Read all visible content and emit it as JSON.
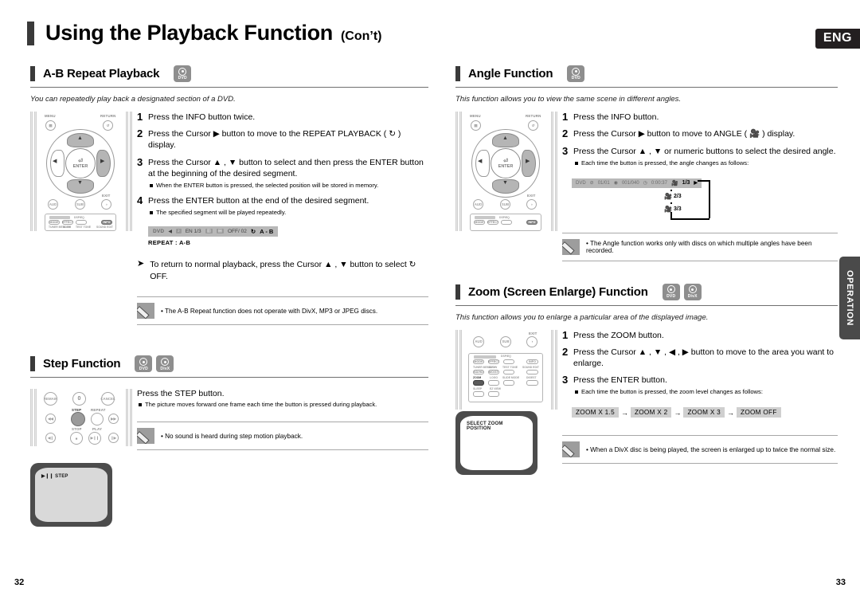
{
  "header": {
    "title_main": "Using the Playback Function",
    "title_sub": "(Con’t)",
    "lang_badge": "ENG"
  },
  "side_tab": {
    "label": "OPERATION"
  },
  "page_numbers": {
    "left": "32",
    "right": "33"
  },
  "sections": {
    "ab_repeat": {
      "title": "A-B Repeat Playback",
      "badges": [
        "DVD"
      ],
      "description": "You can repeatedly play back a designated section of a DVD.",
      "steps": [
        {
          "num": "1",
          "text": "Press the INFO button twice.",
          "bold": [
            "INFO"
          ]
        },
        {
          "num": "2",
          "text": "Press the Cursor ▶ button to move to the REPEAT PLAYBACK ( ↻ ) display."
        },
        {
          "num": "3",
          "text": "Press the Cursor ▲ , ▼ button to select <A-> and then press the ENTER button at the beginning of the desired segment.",
          "note": "When the ENTER button is pressed, the selected position will be stored in memory."
        },
        {
          "num": "4",
          "text": "Press the ENTER button at the end of the desired segment.",
          "note": "The specified segment will be played repeatedly."
        }
      ],
      "osd": {
        "disc": "DVD",
        "audio": "EN 1/3",
        "subtitle": "OFF/ 02",
        "mode": "A - B",
        "caption": "REPEAT : A-B"
      },
      "return_note": "To return to normal playback, press the Cursor ▲ , ▼ button to select ↻ OFF.",
      "note": "• The A-B Repeat function does not operate with DivX, MP3 or JPEG discs."
    },
    "step_function": {
      "title": "Step Function",
      "badges": [
        "DVD",
        "DivX"
      ],
      "lead": "Press the STEP button.",
      "lead_bold": "STEP",
      "bullet": "The picture moves forward one frame each time the button is pressed during playback.",
      "note": "• No sound is heard during step motion playback.",
      "tv_label": "▶❙❙ STEP"
    },
    "angle_function": {
      "title": "Angle Function",
      "badges": [
        "DVD"
      ],
      "description": "This function allows you to view the same scene in different angles.",
      "steps": [
        {
          "num": "1",
          "text": "Press the INFO button."
        },
        {
          "num": "2",
          "text": "Press the Cursor ▶ button to move to ANGLE ( 🎥 ) display."
        },
        {
          "num": "3",
          "text": "Press the Cursor ▲ , ▼ or numeric buttons to select the desired angle.",
          "note": "Each time the button is pressed, the angle changes as follows:"
        }
      ],
      "osd": {
        "disc": "DVD",
        "chapter": "01/01",
        "track": "001/040",
        "time": "0:00:37",
        "angle": "1/3"
      },
      "angle_options": [
        "1/3",
        "2/3",
        "3/3"
      ],
      "note": "• The Angle function works only with discs on which multiple angles have been recorded."
    },
    "zoom_function": {
      "title": "Zoom (Screen Enlarge) Function",
      "badges": [
        "DVD",
        "DivX"
      ],
      "description": "This function allows you to enlarge a particular area of the displayed image.",
      "steps": [
        {
          "num": "1",
          "text": "Press the ZOOM button."
        },
        {
          "num": "2",
          "text": "Press the Cursor ▲ , ▼ , ◀ , ▶  button to move to the area you want to enlarge."
        },
        {
          "num": "3",
          "text": "Press the ENTER button.",
          "note": "Each time the button is pressed, the zoom level changes as follows:"
        }
      ],
      "zoom_levels": [
        "ZOOM X 1.5",
        "ZOOM X 2",
        "ZOOM X 3",
        "ZOOM OFF"
      ],
      "zoom_arrow": "→",
      "tv_label": "SELECT ZOOM POSITION",
      "note": "• When a DivX disc is being played, the screen is enlarged up to twice the normal size."
    }
  },
  "remote_labels": {
    "menu": "MENU",
    "return": "RETURN",
    "enter": "ENTER",
    "exit": "EXIT",
    "audio": "AUDIO",
    "subtitle": "SUB TITLE",
    "info": "INFO",
    "mode": "MODE",
    "effect": "EFFECT",
    "dsp_eq": "DSP/EQ",
    "tuner_memory": "TUNER MEMORY",
    "slow": "SLOW",
    "test_tone": "TEST TONE",
    "sound_edit": "SOUND EDIT",
    "sd_hd": "SD/HD",
    "mo_st": "MO/ST",
    "zoom": "ZOOM",
    "logo": "LOGO",
    "slide_mode": "SLIDE MODE",
    "digest": "DIGEST",
    "sleep": "SLEEP",
    "ez_view": "EZ VIEW",
    "remain": "REMAIN",
    "zero": "0",
    "cancel": "CANCEL",
    "step": "STEP",
    "repeat": "REPEAT",
    "stop": "STOP",
    "play": "PLAY"
  },
  "colors": {
    "accent_dark": "#3a3a3a",
    "badge_grey": "#8e8e8e",
    "osd_grey": "#b8b8b8",
    "chip_grey": "#cfcfcf",
    "tv_bezel": "#4c4c4c"
  }
}
